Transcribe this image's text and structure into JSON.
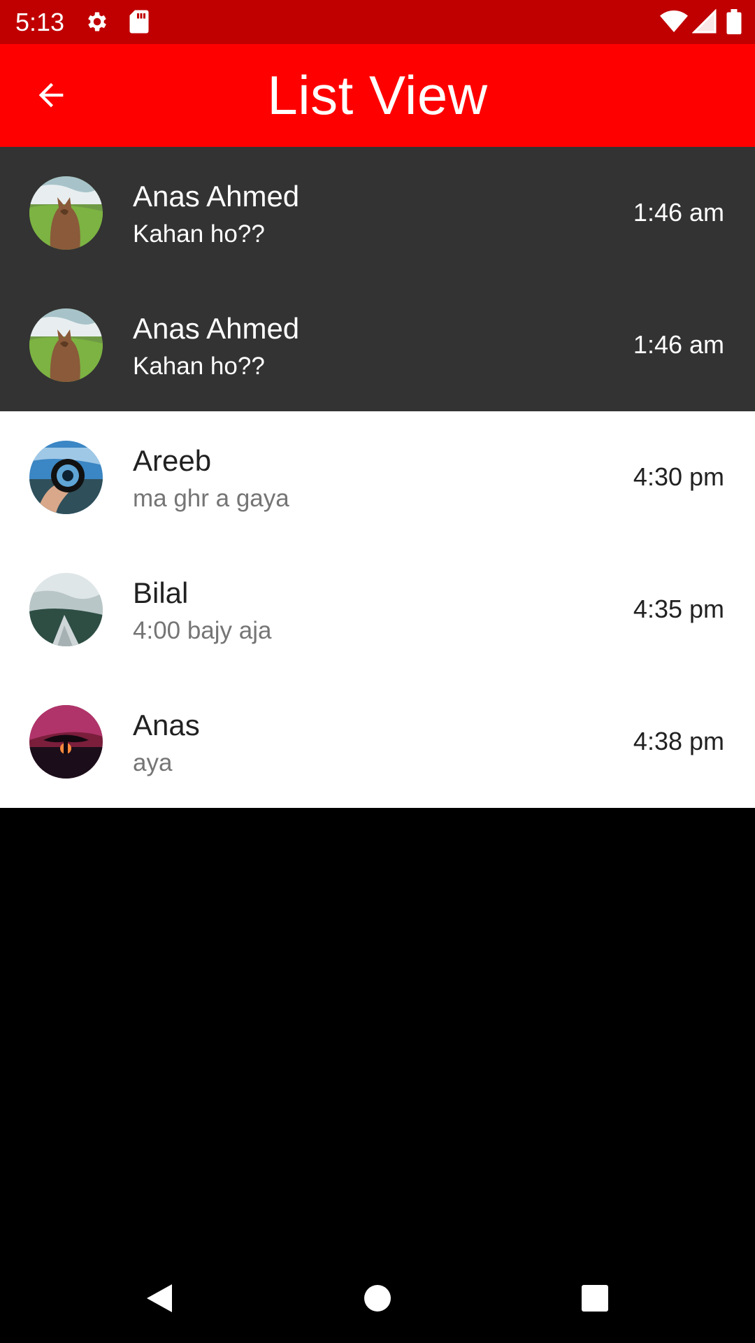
{
  "status_bar": {
    "time": "5:13",
    "icons": [
      "gear-icon",
      "sd-card-icon",
      "wifi-icon",
      "signal-icon",
      "battery-icon"
    ],
    "background": "#c00000"
  },
  "app_bar": {
    "title": "List View",
    "back_icon": "arrow-back-icon",
    "background": "#ff0000"
  },
  "list": {
    "items": [
      {
        "name": "Anas Ahmed",
        "message": "Kahan ho??",
        "time": "1:46 am",
        "avatar": "squirrel-photo",
        "highlighted": true
      },
      {
        "name": "Anas Ahmed",
        "message": "Kahan ho??",
        "time": "1:46 am",
        "avatar": "squirrel-photo",
        "highlighted": true
      },
      {
        "name": "Areeb",
        "message": "ma ghr a gaya",
        "time": "4:30 pm",
        "avatar": "lens-photo",
        "highlighted": false
      },
      {
        "name": "Bilal",
        "message": "4:00 bajy aja",
        "time": "4:35 pm",
        "avatar": "building-fog-photo",
        "highlighted": false
      },
      {
        "name": "Anas",
        "message": "aya",
        "time": "4:38 pm",
        "avatar": "tree-sunset-photo",
        "highlighted": false
      }
    ],
    "highlight_color": "#333333"
  },
  "nav_bar": {
    "icons": [
      "nav-back-icon",
      "nav-home-icon",
      "nav-recents-icon"
    ]
  }
}
